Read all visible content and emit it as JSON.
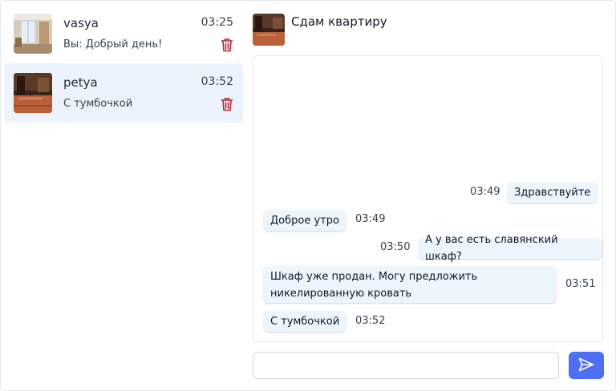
{
  "chats": [
    {
      "name": "vasya",
      "preview": "Вы: Добрый день!",
      "time": "03:25",
      "active": false
    },
    {
      "name": "petya",
      "preview": "С тумбочкой",
      "time": "03:52",
      "active": true
    }
  ],
  "header": {
    "title": "Сдам квартиру"
  },
  "messages": [
    {
      "text": "Здравствуйте",
      "time": "03:49",
      "side": "right"
    },
    {
      "text": "Доброе утро",
      "time": "03:49",
      "side": "left"
    },
    {
      "text": "А у вас есть славянский шкаф?",
      "time": "03:50",
      "side": "right"
    },
    {
      "text": "Шкаф уже продан. Могу предложить никелированную кровать",
      "time": "03:51",
      "side": "left"
    },
    {
      "text": "С тумбочкой",
      "time": "03:52",
      "side": "left"
    }
  ],
  "composer": {
    "placeholder": ""
  },
  "icons": {
    "trash": "trash-icon",
    "send": "send-icon"
  },
  "colors": {
    "accent": "#4e6ff5",
    "active_bg": "#edf3fd",
    "bubble_bg": "#edf5fd",
    "trash": "#b3263a"
  }
}
